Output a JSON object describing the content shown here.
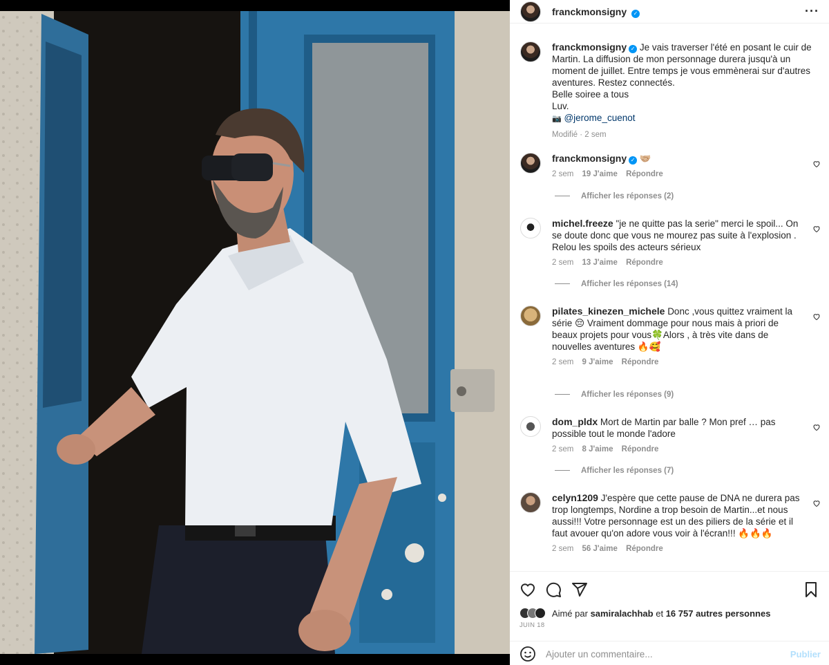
{
  "post": {
    "author": "franckmonsigny",
    "verified_mark": "✓",
    "more_icon": "···",
    "caption_lines": [
      "Je vais traverser l'été en posant le cuir de",
      "Martin. La diffusion de mon personnage durera jusqu'à un",
      "moment de juillet. Entre temps je vous emmènerai sur d'autres",
      "aventures. Restez connectés.",
      "Belle soiree a tous",
      "Luv."
    ],
    "credit_icon": "📷",
    "credit_mention": "@jerome_cuenot",
    "edited_meta": "Modifié · 2 sem"
  },
  "comments": [
    {
      "user": "franckmonsigny",
      "verified": true,
      "text": "🤝🏼",
      "time": "2 sem",
      "likes": "19 J'aime",
      "reply": "Répondre",
      "replies": "Afficher les réponses (2)"
    },
    {
      "user": "michel.freeze",
      "text": "\"je ne quitte pas la serie\" merci le spoil... On se doute donc que vous ne mourez pas suite à l'explosion . Relou les spoils des acteurs sérieux",
      "time": "2 sem",
      "likes": "13 J'aime",
      "reply": "Répondre",
      "replies": "Afficher les réponses (14)"
    },
    {
      "user": "pilates_kinezen_michele",
      "text": "Donc ,vous quittez vraiment la série 😔 Vraiment dommage pour nous mais à priori de beaux projets pour vous🍀Alors , à très vite dans de nouvelles aventures 🔥🥰",
      "time": "2 sem",
      "likes": "9 J'aime",
      "reply": "Répondre",
      "replies": "Afficher les réponses (9)"
    },
    {
      "user": "dom_pldx",
      "text": "Mort de Martin par balle ? Mon pref … pas possible tout le monde l'adore",
      "time": "2 sem",
      "likes": "8 J'aime",
      "reply": "Répondre",
      "replies": "Afficher les réponses (7)"
    },
    {
      "user": "celyn1209",
      "text": "J'espère que cette pause de DNA ne durera pas trop longtemps, Nordine a trop besoin de Martin...et nous aussi!!! Votre personnage est un des piliers de la série et il faut avouer qu'on adore vous voir à l'écran!!! 🔥🔥🔥",
      "time": "2 sem",
      "likes": "56 J'aime",
      "reply": "Répondre",
      "replies": ""
    }
  ],
  "footer": {
    "liked_by_prefix": "Aimé par",
    "liked_by_user": "samiralachhab",
    "liked_by_and": "et",
    "liked_by_others": "16 757 autres personnes",
    "date": "JUIN 18",
    "comment_placeholder": "Ajouter un commentaire...",
    "publish_label": "Publier"
  },
  "icons": {
    "heart": "heart-icon",
    "comment": "comment-icon",
    "share": "paper-plane-icon",
    "save": "bookmark-icon",
    "emoji": "emoji-icon"
  },
  "colors": {
    "verified": "#0095f6",
    "link": "#00376b",
    "muted": "#8e8e8e",
    "publish_disabled": "#b2dffc"
  }
}
